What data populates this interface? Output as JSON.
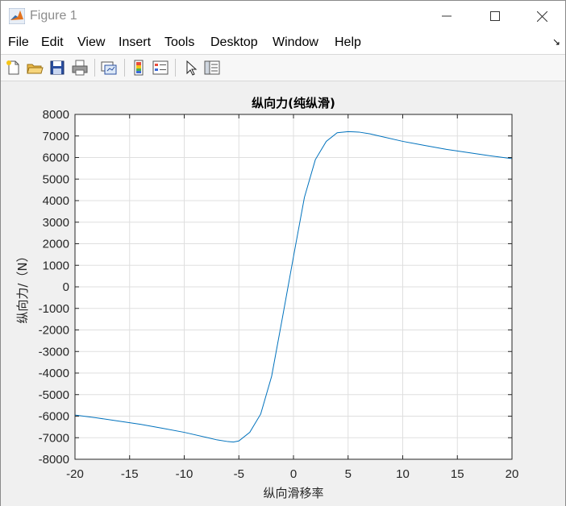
{
  "window": {
    "title": "Figure 1"
  },
  "menu": {
    "items": [
      "File",
      "Edit",
      "View",
      "Insert",
      "Tools",
      "Desktop",
      "Window",
      "Help"
    ],
    "arrow": "↘"
  },
  "toolbar": {
    "buttons": [
      "new-figure-icon",
      "open-file-icon",
      "save-icon",
      "print-icon",
      "link-plot-icon",
      "insert-colorbar-icon",
      "insert-legend-icon",
      "edit-plot-icon",
      "property-inspector-icon"
    ]
  },
  "colors": {
    "line": "#0072bd",
    "grid": "#dfdfdf",
    "axes_bg": "#ffffff",
    "figure_bg": "#f0f0f0"
  },
  "chart_data": {
    "type": "line",
    "title": "纵向力(纯纵滑)",
    "xlabel": "纵向滑移率",
    "ylabel": "纵向力/（N）",
    "xlim": [
      -20,
      20
    ],
    "ylim": [
      -8000,
      8000
    ],
    "xticks": [
      "-20",
      "-15",
      "-10",
      "-5",
      "0",
      "5",
      "10",
      "15",
      "20"
    ],
    "yticks": [
      "8000",
      "7000",
      "6000",
      "5000",
      "4000",
      "3000",
      "2000",
      "1000",
      "0",
      "-1000",
      "-2000",
      "-3000",
      "-4000",
      "-5000",
      "-6000",
      "-7000",
      "-8000"
    ],
    "grid": true,
    "series": [
      {
        "x": [
          -20,
          -18,
          -16,
          -14,
          -12,
          -10,
          -8,
          -7,
          -6,
          -5.5,
          -5,
          -4,
          -3,
          -2,
          -1,
          0,
          1,
          2,
          3,
          4,
          5,
          5.5,
          6,
          7,
          8,
          10,
          12,
          14,
          16,
          18,
          20
        ],
        "values": [
          -5950,
          -6080,
          -6230,
          -6380,
          -6560,
          -6750,
          -6980,
          -7100,
          -7180,
          -7200,
          -7150,
          -6750,
          -5900,
          -4150,
          -1400,
          1400,
          4150,
          5900,
          6750,
          7150,
          7200,
          7190,
          7180,
          7100,
          6980,
          6750,
          6560,
          6380,
          6230,
          6080,
          5950
        ]
      }
    ]
  }
}
